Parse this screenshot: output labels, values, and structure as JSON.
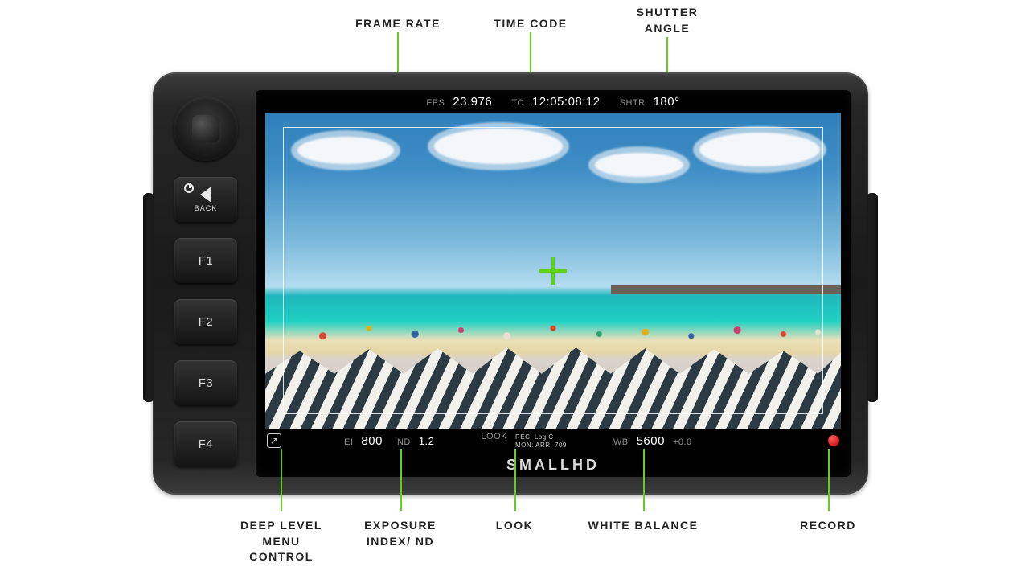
{
  "annotations": {
    "top": {
      "frame_rate": "FRAME RATE",
      "time_code": "TIME CODE",
      "shutter_angle": "SHUTTER\nANGLE"
    },
    "bottom": {
      "menu": "DEEP LEVEL\nMENU\nCONTROL",
      "ei_nd": "EXPOSURE\nINDEX/ ND",
      "look": "LOOK",
      "wb": "WHITE BALANCE",
      "record": "RECORD"
    }
  },
  "hardware": {
    "back_label": "BACK",
    "f1": "F1",
    "f2": "F2",
    "f3": "F3",
    "f4": "F4"
  },
  "osd_top": {
    "fps_k": "FPS",
    "fps_v": "23.976",
    "tc_k": "TC",
    "tc_v": "12:05:08:12",
    "shtr_k": "SHTR",
    "shtr_v": "180°"
  },
  "osd_bottom": {
    "menu_glyph": "↗",
    "ei_k": "EI",
    "ei_v": "800",
    "nd_k": "ND",
    "nd_v": "1.2",
    "look_k": "LOOK",
    "look_line1": "REC: Log C",
    "look_line2": "MON: ARRI 709",
    "wb_k": "WB",
    "wb_v": "5600",
    "wb_tint": "+0.0"
  },
  "brand": "SMALLHD"
}
